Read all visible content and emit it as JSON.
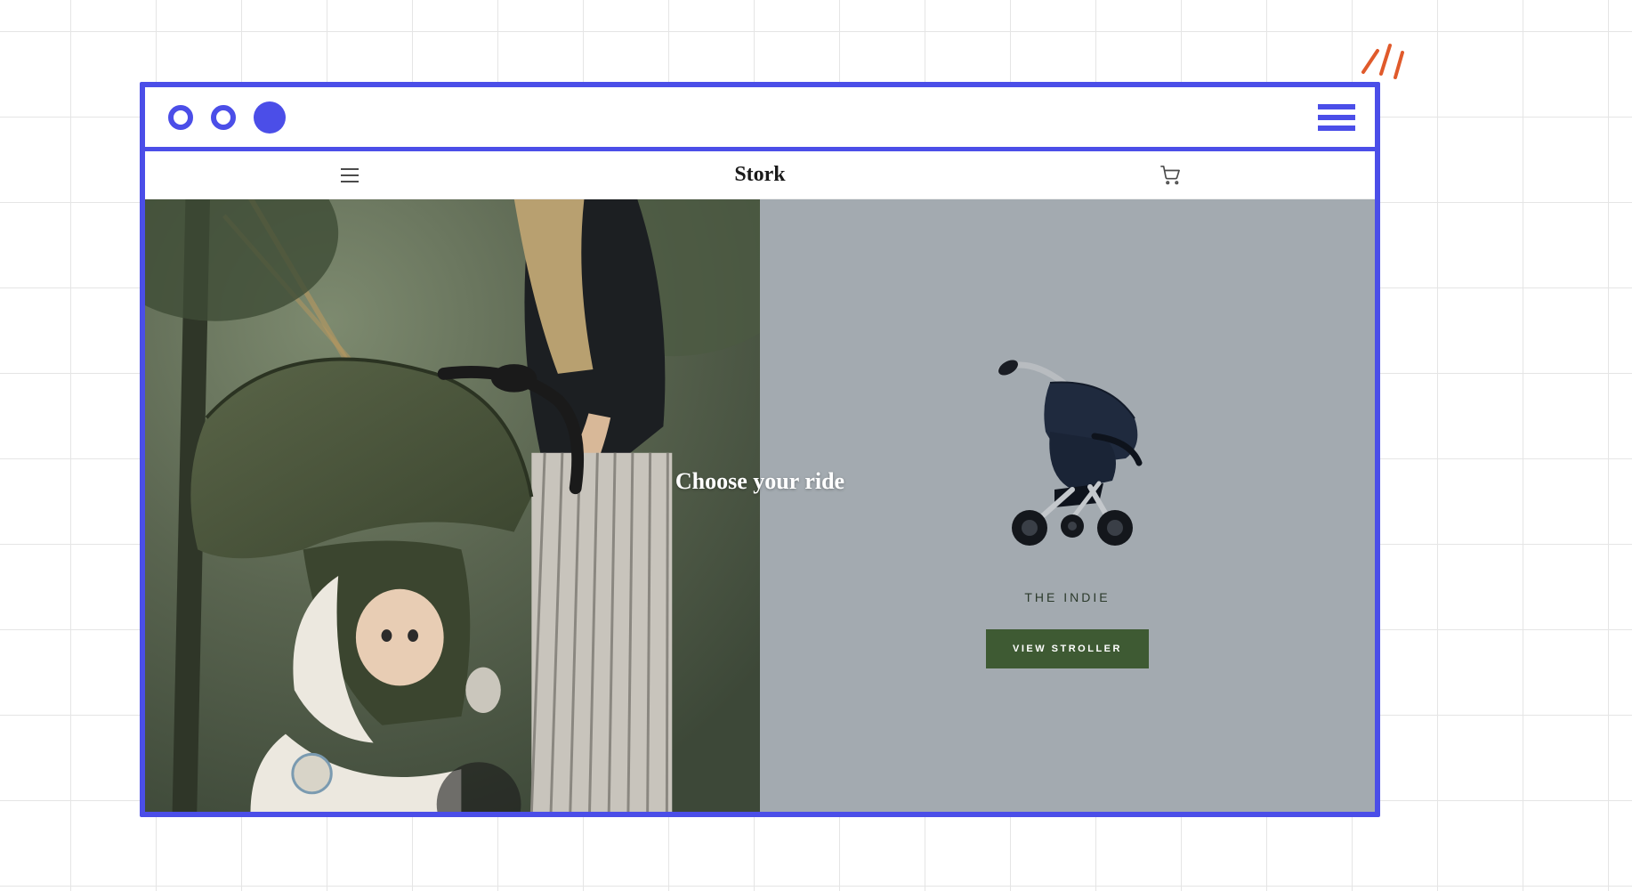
{
  "header": {
    "brand": "Stork",
    "menu_icon": "menu-icon",
    "cart_icon": "cart-icon"
  },
  "hero": {
    "heading": "Choose your ride",
    "product_name": "THE INDIE",
    "cta_label": "VIEW STROLLER"
  },
  "colors": {
    "frame": "#4B4EE8",
    "cta_bg": "#3e5a33",
    "right_panel": "#a3aab0",
    "burst": "#E05A2B"
  },
  "browser": {
    "dots": [
      "outline",
      "outline",
      "solid"
    ],
    "menu_icon": "hamburger-icon"
  }
}
